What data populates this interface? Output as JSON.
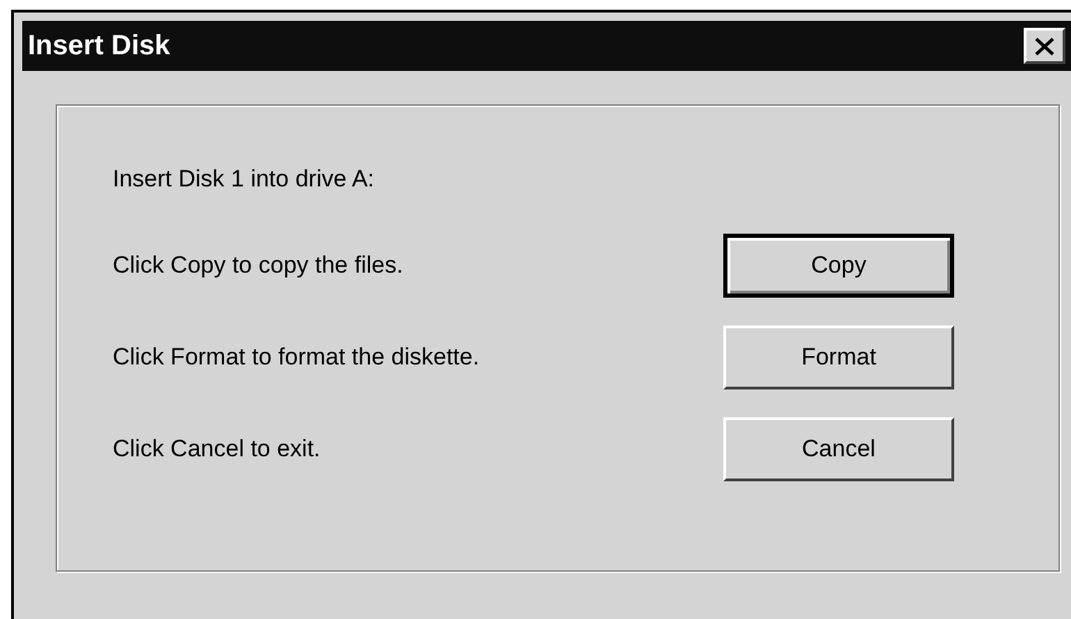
{
  "window": {
    "title": "Insert Disk"
  },
  "message": "Insert Disk 1 into drive A:",
  "actions": [
    {
      "instruction": "Click Copy to copy the files.",
      "button": "Copy",
      "default": true
    },
    {
      "instruction": "Click Format to format the diskette.",
      "button": "Format",
      "default": false
    },
    {
      "instruction": "Click Cancel to exit.",
      "button": "Cancel",
      "default": false
    }
  ]
}
